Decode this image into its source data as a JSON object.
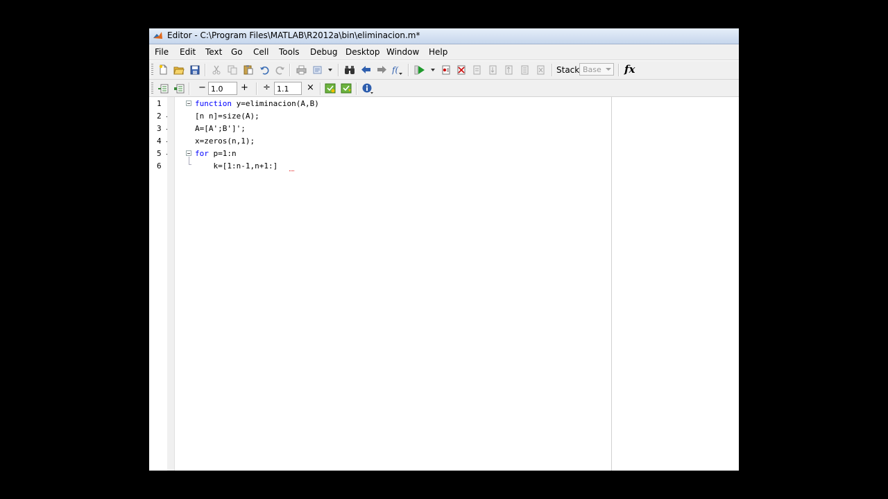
{
  "window": {
    "title": "Editor - C:\\Program Files\\MATLAB\\R2012a\\bin\\eliminacion.m*"
  },
  "menu": [
    "File",
    "Edit",
    "Text",
    "Go",
    "Cell",
    "Tools",
    "Debug",
    "Desktop",
    "Window",
    "Help"
  ],
  "toolbar": {
    "stack_label": "Stack:",
    "stack_value": "Base",
    "fx_label": "fx",
    "icons": [
      "new-file-icon",
      "open-folder-icon",
      "save-icon",
      "cut-icon",
      "copy-icon",
      "paste-icon",
      "undo-icon",
      "redo-icon",
      "print-icon",
      "publish-icon",
      "find-icon",
      "back-arrow-icon",
      "forward-arrow-icon",
      "function-browser-icon",
      "run-icon",
      "set-breakpoint-icon",
      "clear-breakpoints-icon",
      "step-icon",
      "step-in-icon",
      "step-out-icon",
      "continue-icon",
      "exit-debug-icon"
    ]
  },
  "cell_toolbar": {
    "minus": "−",
    "increment_value": "1.0",
    "plus": "+",
    "divide": "÷",
    "scale_value": "1.1",
    "times": "×"
  },
  "code": {
    "line_numbers": [
      "1",
      "2",
      "3",
      "4",
      "5",
      "6"
    ],
    "lines": [
      {
        "keyword": "function",
        "rest": " y=eliminacion(A,B)"
      },
      {
        "keyword": "",
        "rest": "[n n]=size(A);"
      },
      {
        "keyword": "",
        "rest": "A=[A';B']';"
      },
      {
        "keyword": "",
        "rest": "x=zeros(n,1);"
      },
      {
        "keyword": "for",
        "rest": " p=1:n"
      },
      {
        "keyword": "",
        "rest": "    k=[1:n-1,n+1:]"
      }
    ]
  }
}
